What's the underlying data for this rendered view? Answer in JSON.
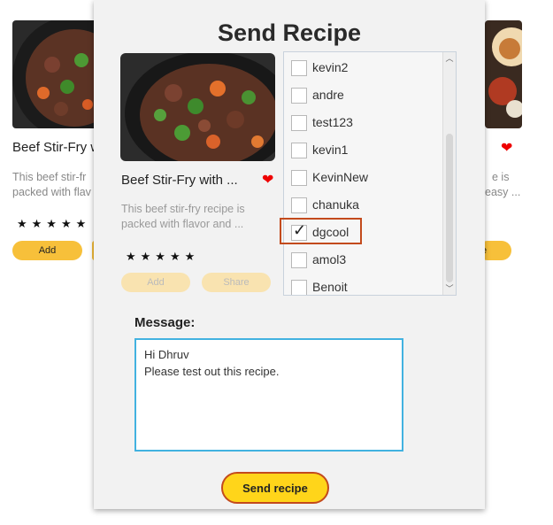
{
  "background": {
    "left_card": {
      "title": "Beef Stir-Fry w",
      "desc_line1": "This beef stir-fr",
      "desc_line2": "packed with flav",
      "stars": "★★★★★",
      "add_label": "Add"
    },
    "right_card": {
      "desc_line1": "e is",
      "desc_line2": "easy ...",
      "button_label": "e"
    }
  },
  "dialog": {
    "title": "Send Recipe",
    "recipe_card": {
      "title": "Beef Stir-Fry with ...",
      "desc": "This beef stir-fry recipe is packed with flavor and ...",
      "stars": "★★★★★",
      "add_label": "Add",
      "share_label": "Share"
    },
    "users": [
      {
        "name": "kevin2",
        "checked": false
      },
      {
        "name": "andre",
        "checked": false
      },
      {
        "name": "test123",
        "checked": false
      },
      {
        "name": "kevin1",
        "checked": false
      },
      {
        "name": "KevinNew",
        "checked": false
      },
      {
        "name": "chanuka",
        "checked": false
      },
      {
        "name": "dgcool",
        "checked": true
      },
      {
        "name": "amol3",
        "checked": false
      },
      {
        "name": "Benoit",
        "checked": false
      }
    ],
    "message_label": "Message:",
    "message_text": "Hi Dhruv\nPlease test out this recipe.",
    "send_label": "Send recipe"
  },
  "colors": {
    "accent_yellow": "#ffd51a",
    "highlight_border": "#c34a1c",
    "focus_border": "#42b2e0",
    "heart": "#e00000"
  }
}
